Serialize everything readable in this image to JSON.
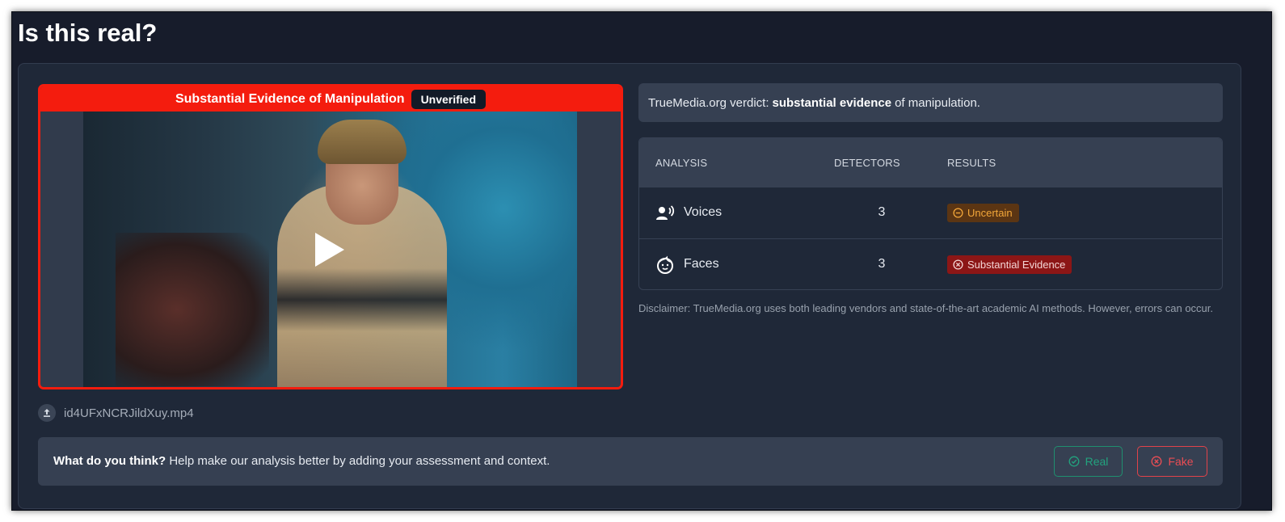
{
  "page": {
    "title": "Is this real?"
  },
  "video": {
    "header_text": "Substantial Evidence of Manipulation",
    "verify_badge": "Unverified",
    "frame_color": "#f41c0e",
    "file_name": "id4UFxNCRJildXuy.mp4"
  },
  "verdict": {
    "prefix": "TrueMedia.org verdict:",
    "emphasis": "substantial evidence",
    "suffix": "of manipulation."
  },
  "analysis_table": {
    "headers": {
      "analysis": "ANALYSIS",
      "detectors": "DETECTORS",
      "results": "RESULTS"
    },
    "rows": [
      {
        "label": "Voices",
        "icon": "voice-user-icon",
        "detectors": "3",
        "result": "Uncertain",
        "result_color": "#f3a73a"
      },
      {
        "label": "Faces",
        "icon": "face-icon",
        "detectors": "3",
        "result": "Substantial Evidence",
        "result_color": "#e2434a"
      }
    ]
  },
  "disclaimer": "Disclaimer: TrueMedia.org uses both leading vendors and state-of-the-art academic AI methods. However, errors can occur.",
  "feedback": {
    "question": "What do you think?",
    "prompt": "Help make our analysis better by adding your assessment and context.",
    "real_label": "Real",
    "fake_label": "Fake"
  }
}
